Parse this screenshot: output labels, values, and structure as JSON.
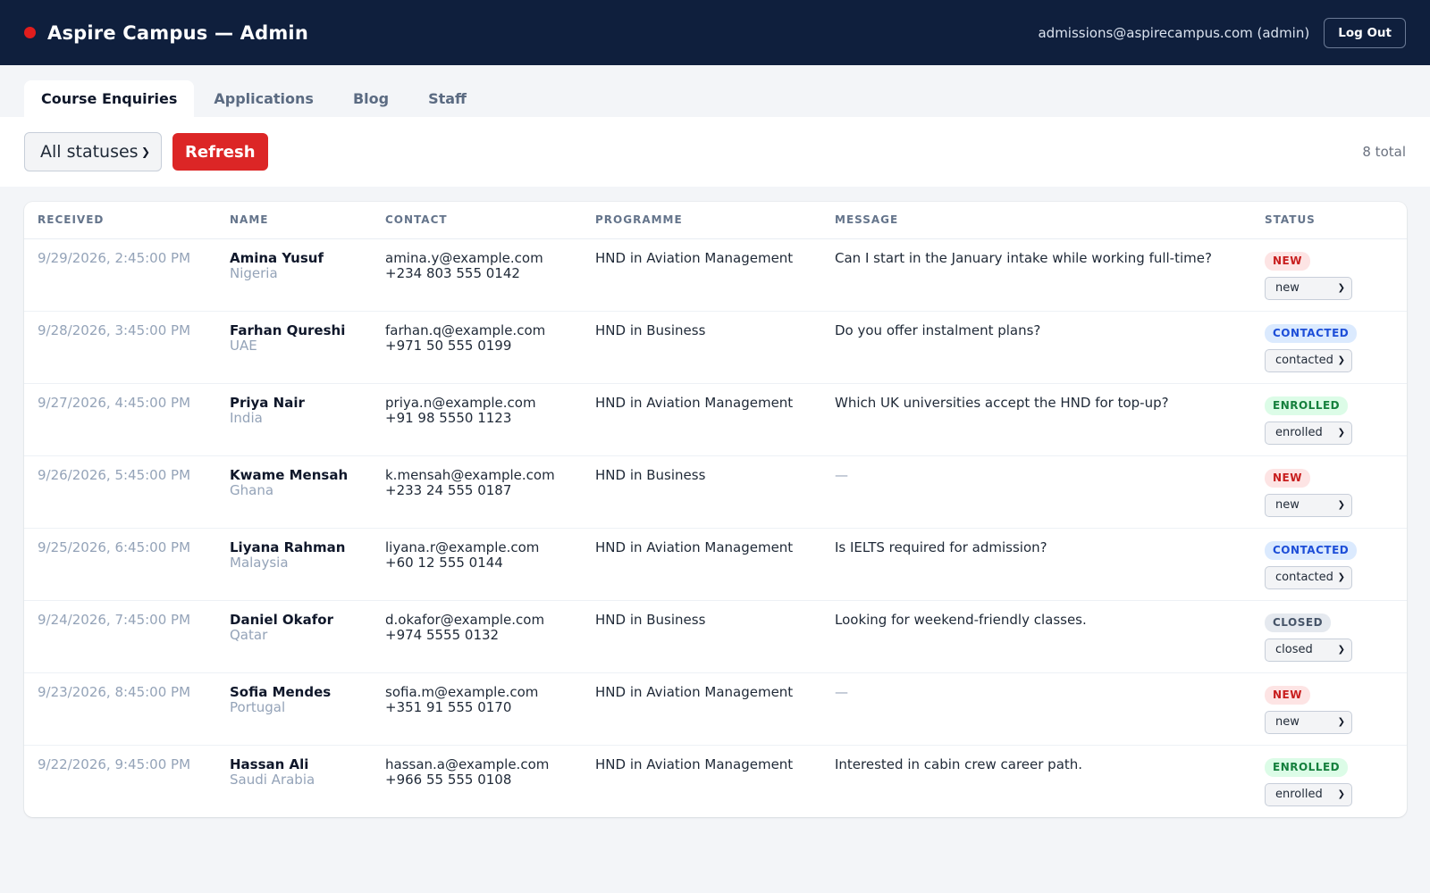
{
  "header": {
    "title": "Aspire Campus — Admin",
    "user": "admissions@aspirecampus.com (admin)",
    "logout_label": "Log Out"
  },
  "tabs": [
    {
      "label": "Course Enquiries",
      "active": true
    },
    {
      "label": "Applications",
      "active": false
    },
    {
      "label": "Blog",
      "active": false
    },
    {
      "label": "Staff",
      "active": false
    }
  ],
  "toolbar": {
    "status_filter": "All statuses",
    "refresh_label": "Refresh",
    "total": "8 total"
  },
  "table": {
    "columns": [
      "RECEIVED",
      "NAME",
      "CONTACT",
      "PROGRAMME",
      "MESSAGE",
      "STATUS"
    ],
    "rows": [
      {
        "received": "9/29/2026, 2:45:00 PM",
        "name": "Amina Yusuf",
        "country": "Nigeria",
        "email": "amina.y@example.com",
        "phone": "+234 803 555 0142",
        "programme": "HND in Aviation Management",
        "message": "Can I start in the January intake while working full-time?",
        "status_badge": "NEW",
        "status_value": "new"
      },
      {
        "received": "9/28/2026, 3:45:00 PM",
        "name": "Farhan Qureshi",
        "country": "UAE",
        "email": "farhan.q@example.com",
        "phone": "+971 50 555 0199",
        "programme": "HND in Business",
        "message": "Do you offer instalment plans?",
        "status_badge": "CONTACTED",
        "status_value": "contacted"
      },
      {
        "received": "9/27/2026, 4:45:00 PM",
        "name": "Priya Nair",
        "country": "India",
        "email": "priya.n@example.com",
        "phone": "+91 98 5550 1123",
        "programme": "HND in Aviation Management",
        "message": "Which UK universities accept the HND for top-up?",
        "status_badge": "ENROLLED",
        "status_value": "enrolled"
      },
      {
        "received": "9/26/2026, 5:45:00 PM",
        "name": "Kwame Mensah",
        "country": "Ghana",
        "email": "k.mensah@example.com",
        "phone": "+233 24 555 0187",
        "programme": "HND in Business",
        "message": "—",
        "status_badge": "NEW",
        "status_value": "new"
      },
      {
        "received": "9/25/2026, 6:45:00 PM",
        "name": "Liyana Rahman",
        "country": "Malaysia",
        "email": "liyana.r@example.com",
        "phone": "+60 12 555 0144",
        "programme": "HND in Aviation Management",
        "message": "Is IELTS required for admission?",
        "status_badge": "CONTACTED",
        "status_value": "contacted"
      },
      {
        "received": "9/24/2026, 7:45:00 PM",
        "name": "Daniel Okafor",
        "country": "Qatar",
        "email": "d.okafor@example.com",
        "phone": "+974 5555 0132",
        "programme": "HND in Business",
        "message": "Looking for weekend-friendly classes.",
        "status_badge": "CLOSED",
        "status_value": "closed"
      },
      {
        "received": "9/23/2026, 8:45:00 PM",
        "name": "Sofia Mendes",
        "country": "Portugal",
        "email": "sofia.m@example.com",
        "phone": "+351 91 555 0170",
        "programme": "HND in Aviation Management",
        "message": "—",
        "status_badge": "NEW",
        "status_value": "new"
      },
      {
        "received": "9/22/2026, 9:45:00 PM",
        "name": "Hassan Ali",
        "country": "Saudi Arabia",
        "email": "hassan.a@example.com",
        "phone": "+966 55 555 0108",
        "programme": "HND in Aviation Management",
        "message": "Interested in cabin crew career path.",
        "status_badge": "ENROLLED",
        "status_value": "enrolled"
      }
    ]
  },
  "colors": {
    "header_bg": "#0f1f3d",
    "accent_red": "#dc2626",
    "badge_new": "#c81e1e",
    "badge_contacted": "#1d4ed8",
    "badge_enrolled": "#15803d",
    "badge_closed": "#475569"
  }
}
